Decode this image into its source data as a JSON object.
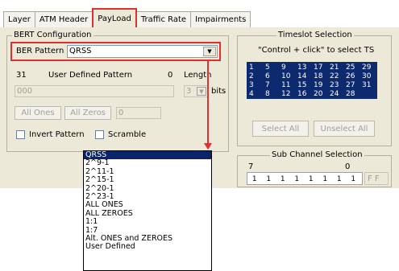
{
  "tabs": [
    "Layer",
    "ATM Header",
    "PayLoad",
    "Traffic Rate",
    "Impairments"
  ],
  "bert": {
    "group_title": "BERT Configuration",
    "ber_pattern_label": "BER Pattern",
    "ber_pattern_value": "QRSS",
    "udp_count": "31",
    "udp_label": "User Defined Pattern",
    "udp_zero": "0",
    "length_label": "Length",
    "pattern_value": "000",
    "length_value": "3",
    "bits_label": "bits",
    "all_ones": "All Ones",
    "all_zeros": "All Zeros",
    "zeros_value": "0",
    "invert_label": "Invert Pattern",
    "scramble_label": "Scramble"
  },
  "timeslot": {
    "group_title": "Timeslot Selection",
    "hint": "\"Control + click\" to select TS",
    "cells": [
      "1",
      "5",
      "9",
      "13",
      "17",
      "21",
      "25",
      "29",
      "2",
      "6",
      "10",
      "14",
      "18",
      "22",
      "26",
      "30",
      "3",
      "7",
      "11",
      "15",
      "19",
      "23",
      "27",
      "31",
      "4",
      "8",
      "12",
      "16",
      "20",
      "24",
      "28"
    ],
    "select_all": "Select All",
    "unselect_all": "Unselect All"
  },
  "subchannel": {
    "group_title": "Sub Channel Selection",
    "left_index": "7",
    "right_index": "0",
    "bits": [
      "1",
      "1",
      "1",
      "1",
      "1",
      "1",
      "1",
      "1"
    ],
    "hex": "F F"
  },
  "dropdown": {
    "items": [
      "QRSS",
      "2^9-1",
      "2^11-1",
      "2^15-1",
      "2^20-1",
      "2^23-1",
      "ALL ONES",
      "ALL ZEROES",
      "1:1",
      "1:7",
      "Alt. ONES and ZEROES",
      "User Defined"
    ],
    "selected": "QRSS"
  },
  "colors": {
    "highlight_red": "#e03030",
    "selection_navy": "#0a246a",
    "panel_bg": "#ece9d8"
  }
}
